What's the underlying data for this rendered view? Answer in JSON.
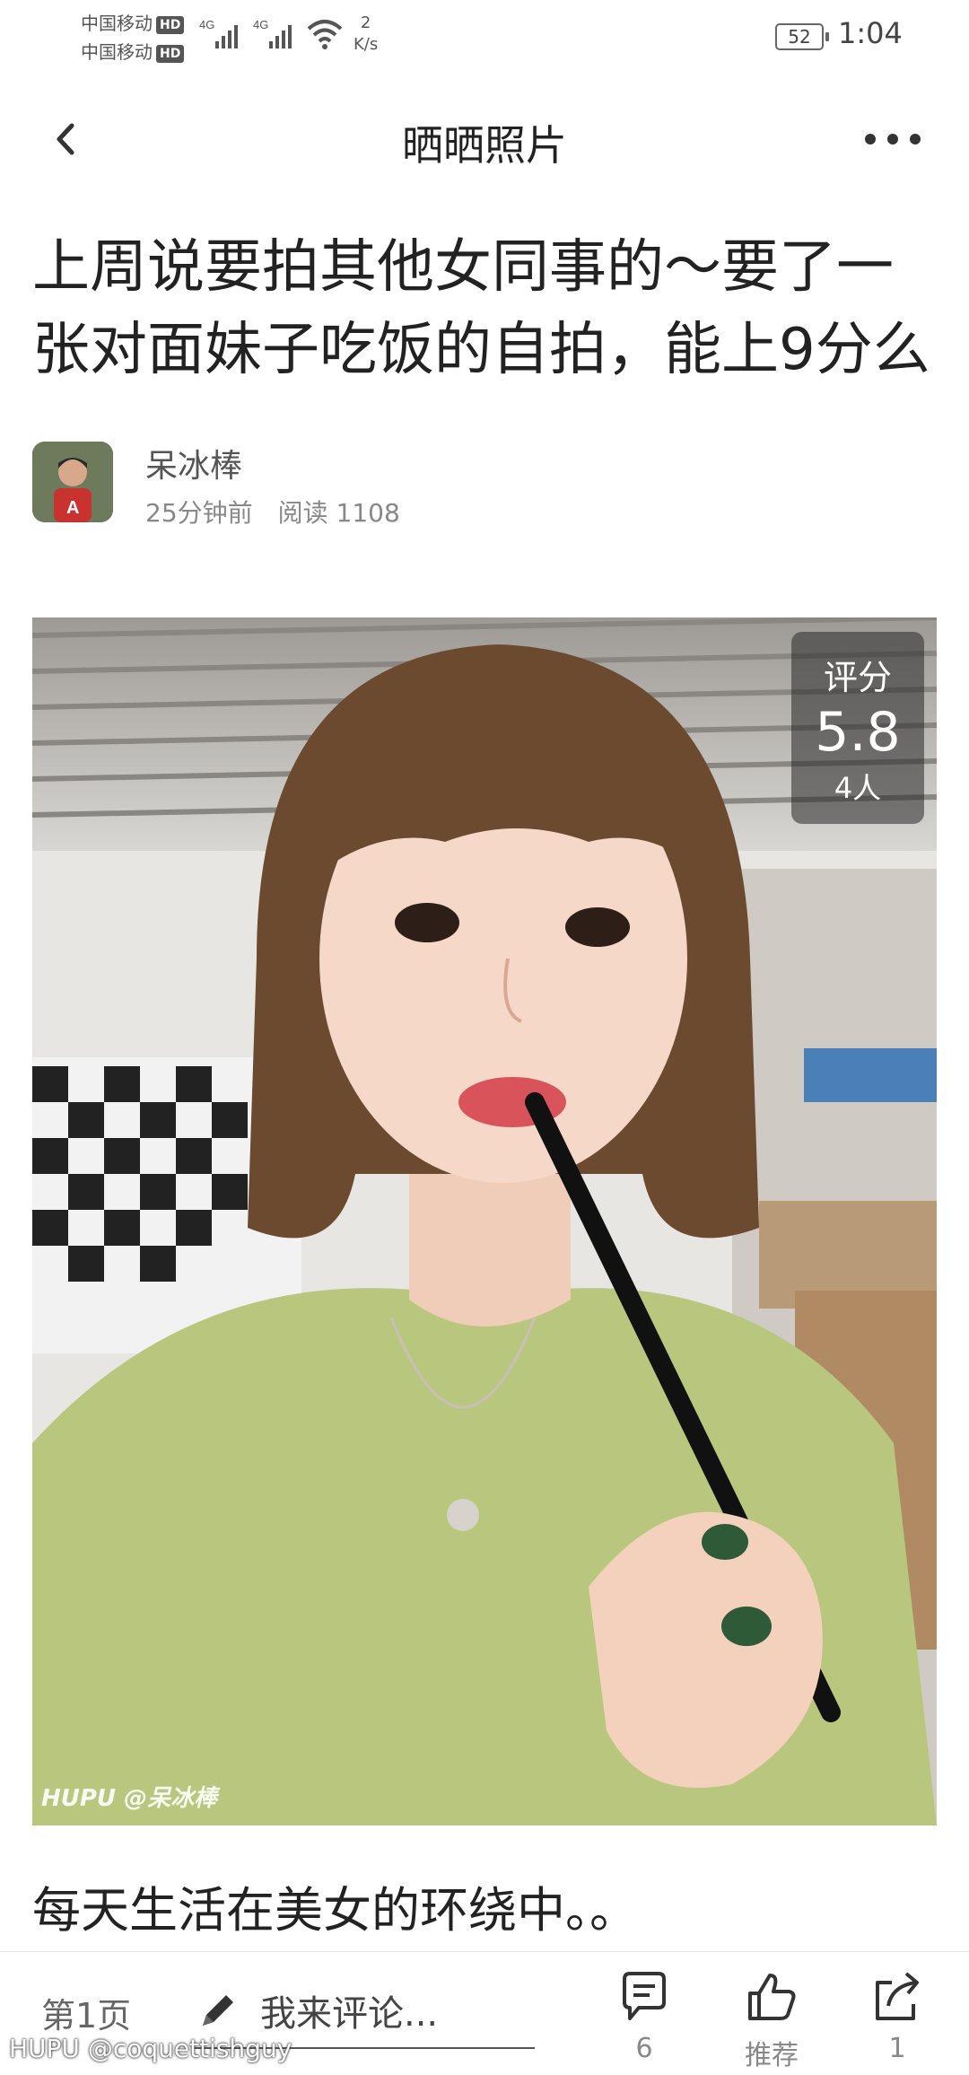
{
  "status_bar": {
    "carrier1": "中国移动",
    "carrier2": "中国移动",
    "hd_badge": "HD",
    "net1": "4G",
    "net2": "4G",
    "speed_value": "2",
    "speed_unit": "K/s",
    "battery": "52",
    "time": "1:04"
  },
  "nav": {
    "title": "晒晒照片"
  },
  "post": {
    "title": "上周说要拍其他女同事的～要了一张对面妹子吃饭的自拍，能上9分么",
    "author": "呆冰棒",
    "time_ago": "25分钟前",
    "reads": "阅读 1108",
    "caption": "每天生活在美女的环绕中。。"
  },
  "rating": {
    "label": "评分",
    "score": "5.8",
    "count": "4人"
  },
  "photo": {
    "watermark": "HUPU @呆冰棒"
  },
  "bottom": {
    "page": "第1页",
    "comment_placeholder": "我来评论...",
    "comments_count": "6",
    "recommend_label": "推荐",
    "share_count": "1"
  },
  "footer": {
    "watermark": "HUPU @coquettishguy"
  }
}
